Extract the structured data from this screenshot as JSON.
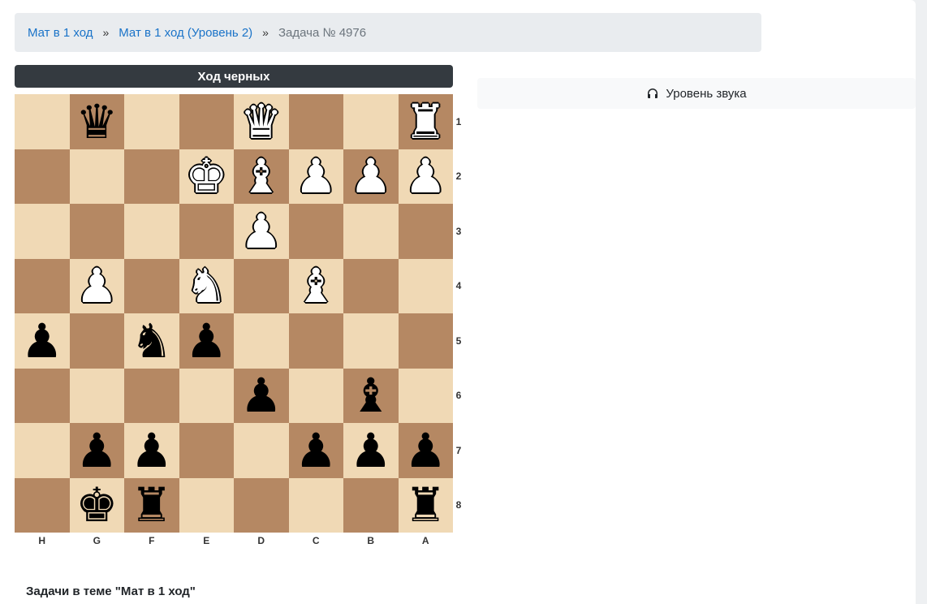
{
  "breadcrumb": {
    "items": [
      "Мат в 1 ход",
      "Мат в 1 ход (Уровень 2)"
    ],
    "separator": "»",
    "current": "Задача № 4976"
  },
  "turn_label": "Ход черных",
  "sound_button": {
    "label": "Уровень звука",
    "icon": "headphones-icon"
  },
  "board": {
    "colors": {
      "light": "#f0d9b5",
      "dark": "#b58863"
    },
    "rank_labels": [
      "1",
      "2",
      "3",
      "4",
      "5",
      "6",
      "7",
      "8"
    ],
    "file_labels": [
      "H",
      "G",
      "F",
      "E",
      "D",
      "C",
      "B",
      "A"
    ],
    "rows": [
      [
        "",
        "bQ",
        "",
        "",
        "wQ",
        "",
        "",
        "wR"
      ],
      [
        "",
        "",
        "",
        "wK",
        "wB",
        "wP",
        "wP",
        "wP"
      ],
      [
        "",
        "",
        "",
        "",
        "wP",
        "",
        "",
        ""
      ],
      [
        "",
        "wP",
        "",
        "wN",
        "",
        "wB",
        "",
        ""
      ],
      [
        "bP",
        "",
        "bN",
        "bP",
        "",
        "",
        "",
        ""
      ],
      [
        "",
        "",
        "",
        "",
        "bP",
        "",
        "bB",
        ""
      ],
      [
        "",
        "bP",
        "bP",
        "",
        "",
        "bP",
        "bP",
        "bP"
      ],
      [
        "",
        "bK",
        "bR",
        "",
        "",
        "",
        "",
        "bR"
      ]
    ]
  },
  "section_title": "Задачи в теме \"Мат в 1 ход\""
}
